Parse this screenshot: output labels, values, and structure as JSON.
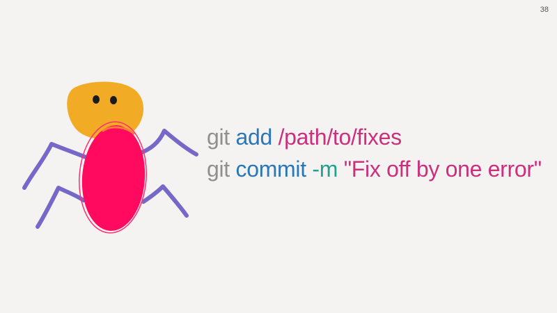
{
  "slide": {
    "page_number": "38"
  },
  "illustration": {
    "subject": "hand-drawn bug",
    "colors": {
      "head": "#f2ab24",
      "eyes": "#1a1a1a",
      "body": "#ff0a5e",
      "legs": "#7668c8"
    }
  },
  "code": {
    "line1": {
      "cmd": "git",
      "sub": "add",
      "arg": "/path/to/fixes"
    },
    "line2": {
      "cmd": "git",
      "sub": "commit",
      "flag": "-m",
      "arg": "\"Fix off by one error\""
    },
    "colors": {
      "cmd": "#8f8f8f",
      "sub": "#2a77b8",
      "flag": "#25a08e",
      "arg": "#cc2f7c"
    }
  }
}
